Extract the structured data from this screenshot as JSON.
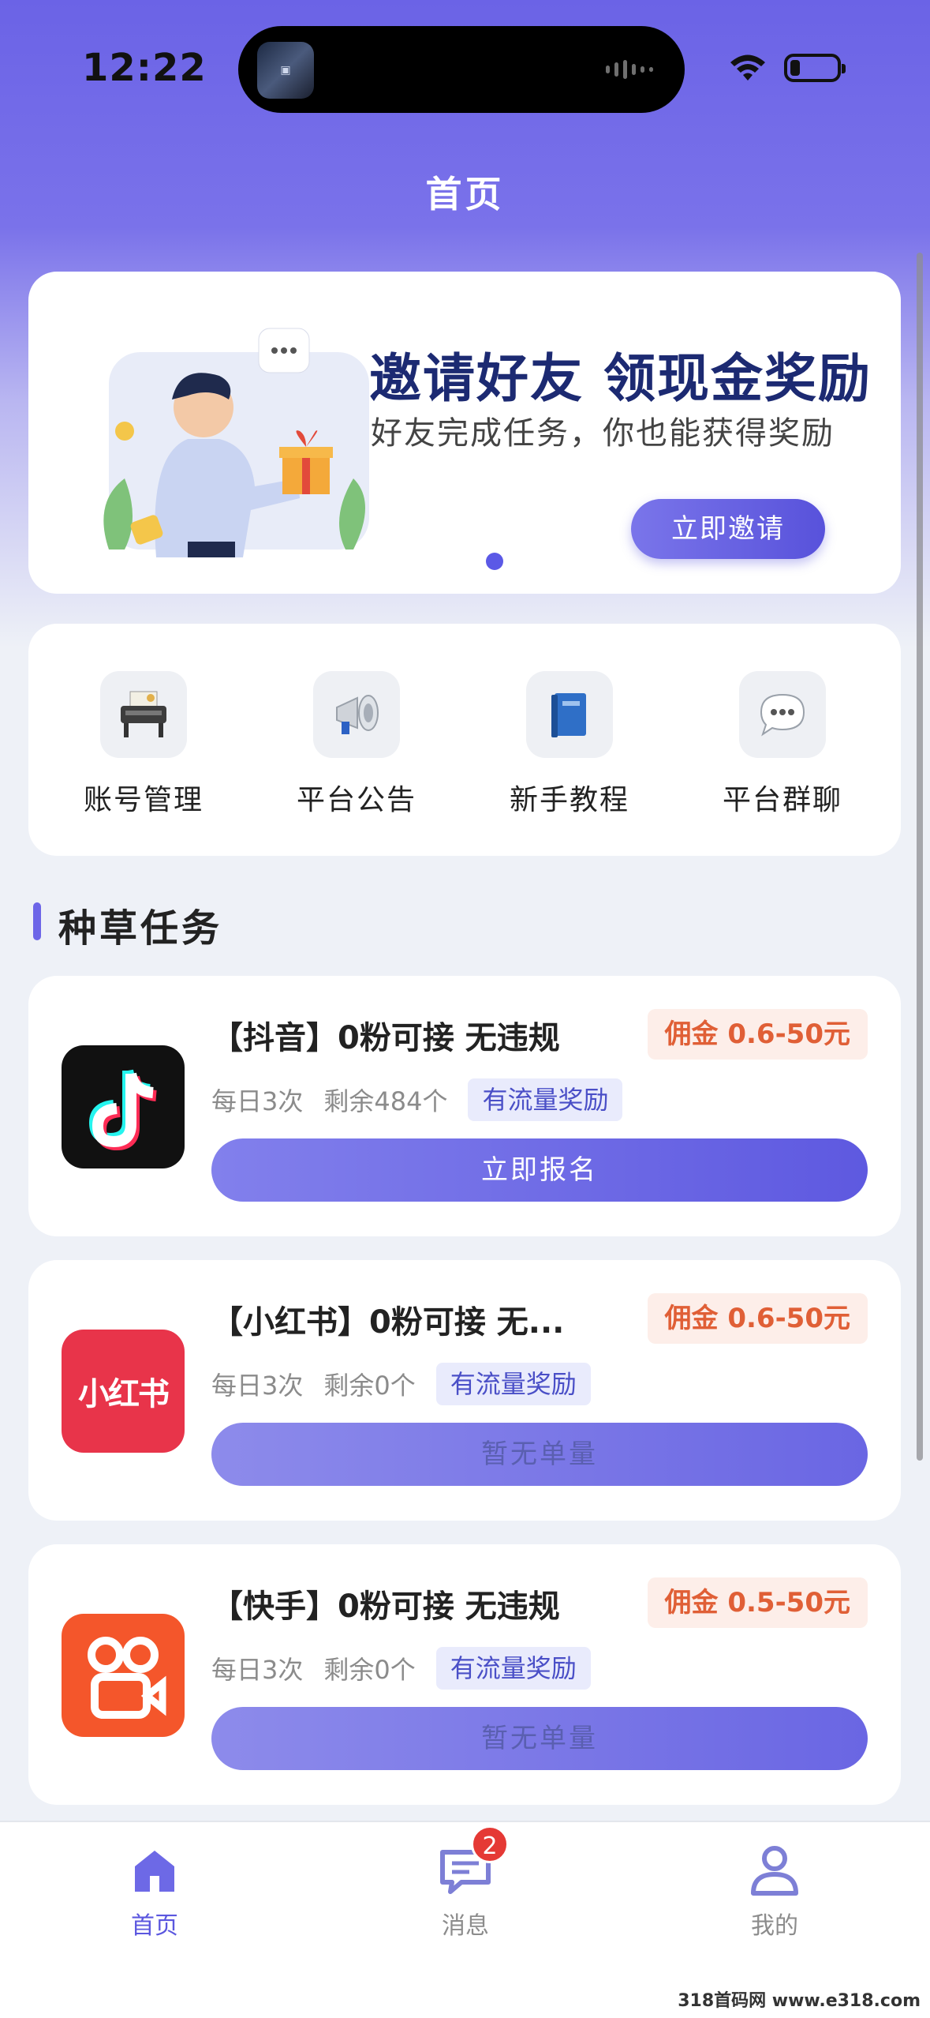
{
  "status_bar": {
    "time": "12:22"
  },
  "header": {
    "title": "首页"
  },
  "banner": {
    "headline": "邀请好友 领现金奖励",
    "subtitle": "好友完成任务，你也能获得奖励",
    "button_label": "立即邀请"
  },
  "quick_menu": [
    {
      "label": "账号管理",
      "icon": "printer-icon"
    },
    {
      "label": "平台公告",
      "icon": "megaphone-icon"
    },
    {
      "label": "新手教程",
      "icon": "book-icon"
    },
    {
      "label": "平台群聊",
      "icon": "chat-bubble-icon"
    }
  ],
  "section": {
    "title": "种草任务"
  },
  "tasks": [
    {
      "app": "douyin",
      "title": "【抖音】0粉可接 无违规",
      "commission": "佣金 0.6-50元",
      "daily": "每日3次",
      "remaining": "剩余484个",
      "tag": "有流量奖励",
      "button": "立即报名"
    },
    {
      "app": "xiaohongshu",
      "logo_text": "小红书",
      "title": "【小红书】0粉可接 无...",
      "commission": "佣金 0.6-50元",
      "daily": "每日3次",
      "remaining": "剩余0个",
      "tag": "有流量奖励",
      "button": "暂无单量"
    },
    {
      "app": "kuaishou",
      "title": "【快手】0粉可接 无违规",
      "commission": "佣金 0.5-50元",
      "daily": "每日3次",
      "remaining": "剩余0个",
      "tag": "有流量奖励",
      "button": "暂无单量"
    }
  ],
  "tabbar": {
    "home": "首页",
    "messages": "消息",
    "messages_badge": "2",
    "mine": "我的"
  },
  "colors": {
    "accent": "#5b57df",
    "commission": "#e05f36",
    "badge": "#e53935"
  },
  "watermark": "318首码网 www.e318.com"
}
